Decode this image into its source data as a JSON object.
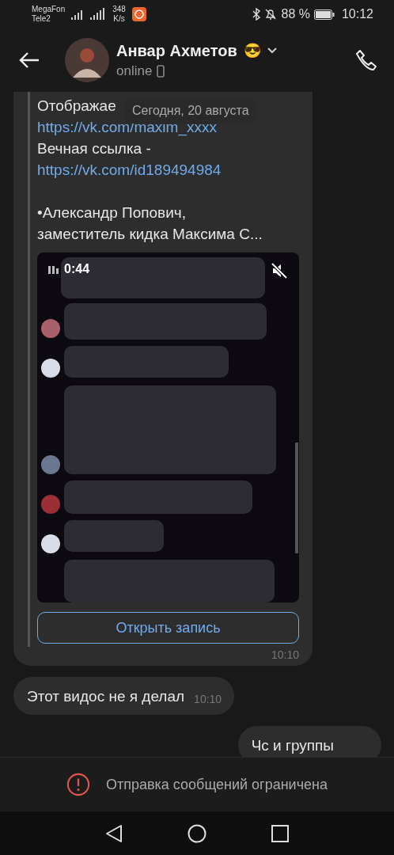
{
  "status_bar": {
    "carriers": [
      "MegaFon",
      "Tele2"
    ],
    "speed": [
      "348",
      "K/s"
    ],
    "battery_percent": "88 %",
    "time": "10:12"
  },
  "header": {
    "name": "Анвар Ахметов",
    "emoji": "😎",
    "status": "online"
  },
  "date_pill": "Сегодня, 20 августа",
  "messages": [
    {
      "kind": "repost",
      "lines": [
        {
          "kind": "text",
          "text": "Отображае"
        },
        {
          "kind": "link",
          "text": "https://vk.com/maxim_xxxx"
        },
        {
          "kind": "text",
          "text": "Вечная ссылка -"
        },
        {
          "kind": "link",
          "text": "https://vk.com/id189494984"
        },
        {
          "kind": "gap"
        },
        {
          "kind": "text",
          "text": "•Александр Попович,"
        },
        {
          "kind": "text",
          "text": "заместитель кидка Максима С..."
        }
      ],
      "video": {
        "kind": "picture",
        "duration": "0:44",
        "muted": true
      },
      "button": "Открыть запись",
      "time": "10:10"
    },
    {
      "kind": "text",
      "text": "Этот видос не я делал",
      "time": "10:10",
      "outgoing": false
    },
    {
      "kind": "text",
      "text": "Чс и группы",
      "outgoing": true
    }
  ],
  "notice": "Отправка сообщений ограничена"
}
